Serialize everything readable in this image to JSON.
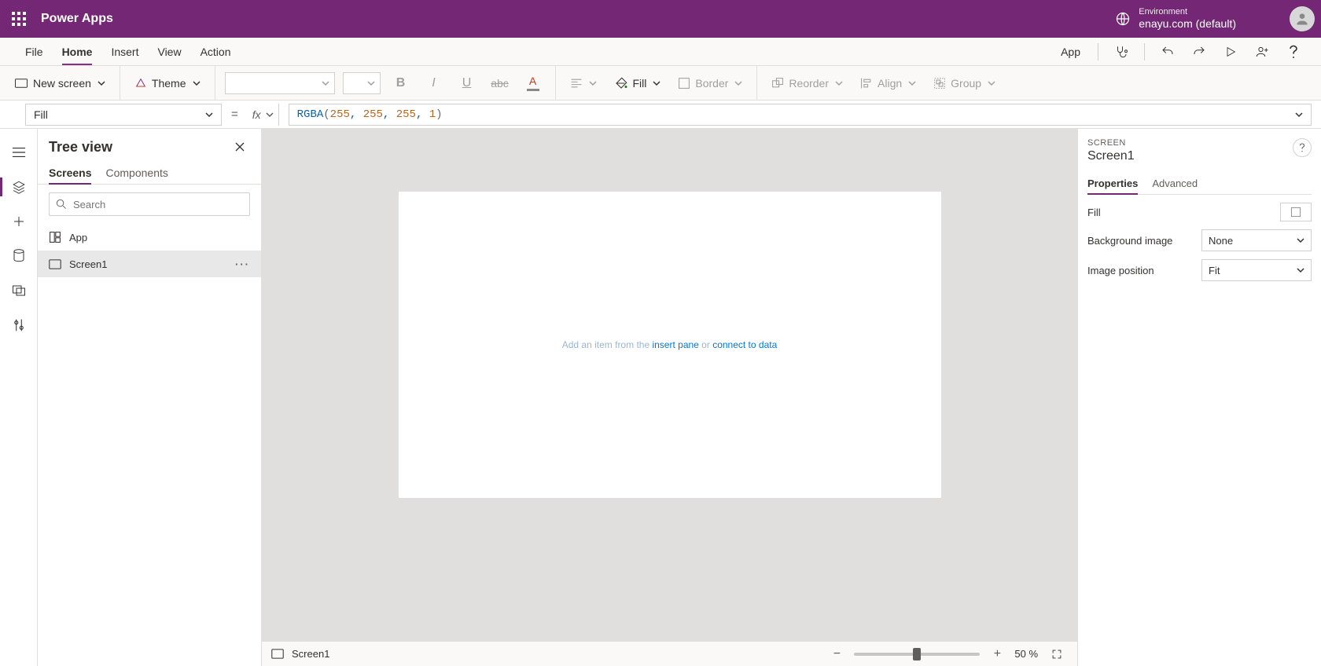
{
  "titlebar": {
    "app_name": "Power Apps",
    "env_label": "Environment",
    "env_value": "enayu.com (default)"
  },
  "menubar": {
    "tabs": [
      "File",
      "Home",
      "Insert",
      "View",
      "Action"
    ],
    "active_index": 1,
    "app_link": "App"
  },
  "ribbon": {
    "new_screen": "New screen",
    "theme": "Theme",
    "fill": "Fill",
    "border": "Border",
    "reorder": "Reorder",
    "align": "Align",
    "group": "Group"
  },
  "formulabar": {
    "property": "Fill",
    "fx": "fx",
    "tokens": {
      "fn": "RGBA",
      "open": "(",
      "n1": "255",
      "n2": "255",
      "n3": "255",
      "n4": "1",
      "comma": ", ",
      "close": ")"
    }
  },
  "tree": {
    "title": "Tree view",
    "tabs": [
      "Screens",
      "Components"
    ],
    "active_tab": 0,
    "search_placeholder": "Search",
    "items": [
      {
        "label": "App",
        "icon": "app"
      },
      {
        "label": "Screen1",
        "icon": "screen",
        "selected": true
      }
    ]
  },
  "canvas": {
    "hint_prefix": "Add an item from the ",
    "hint_link1": "insert pane",
    "hint_mid": " or ",
    "hint_link2": "connect to data"
  },
  "statusbar": {
    "selection": "Screen1",
    "zoom_value": "50",
    "zoom_suffix": " %"
  },
  "properties": {
    "kind": "SCREEN",
    "name": "Screen1",
    "tabs": [
      "Properties",
      "Advanced"
    ],
    "active_tab": 0,
    "rows": {
      "fill_label": "Fill",
      "bgimage_label": "Background image",
      "bgimage_value": "None",
      "imgpos_label": "Image position",
      "imgpos_value": "Fit"
    }
  }
}
